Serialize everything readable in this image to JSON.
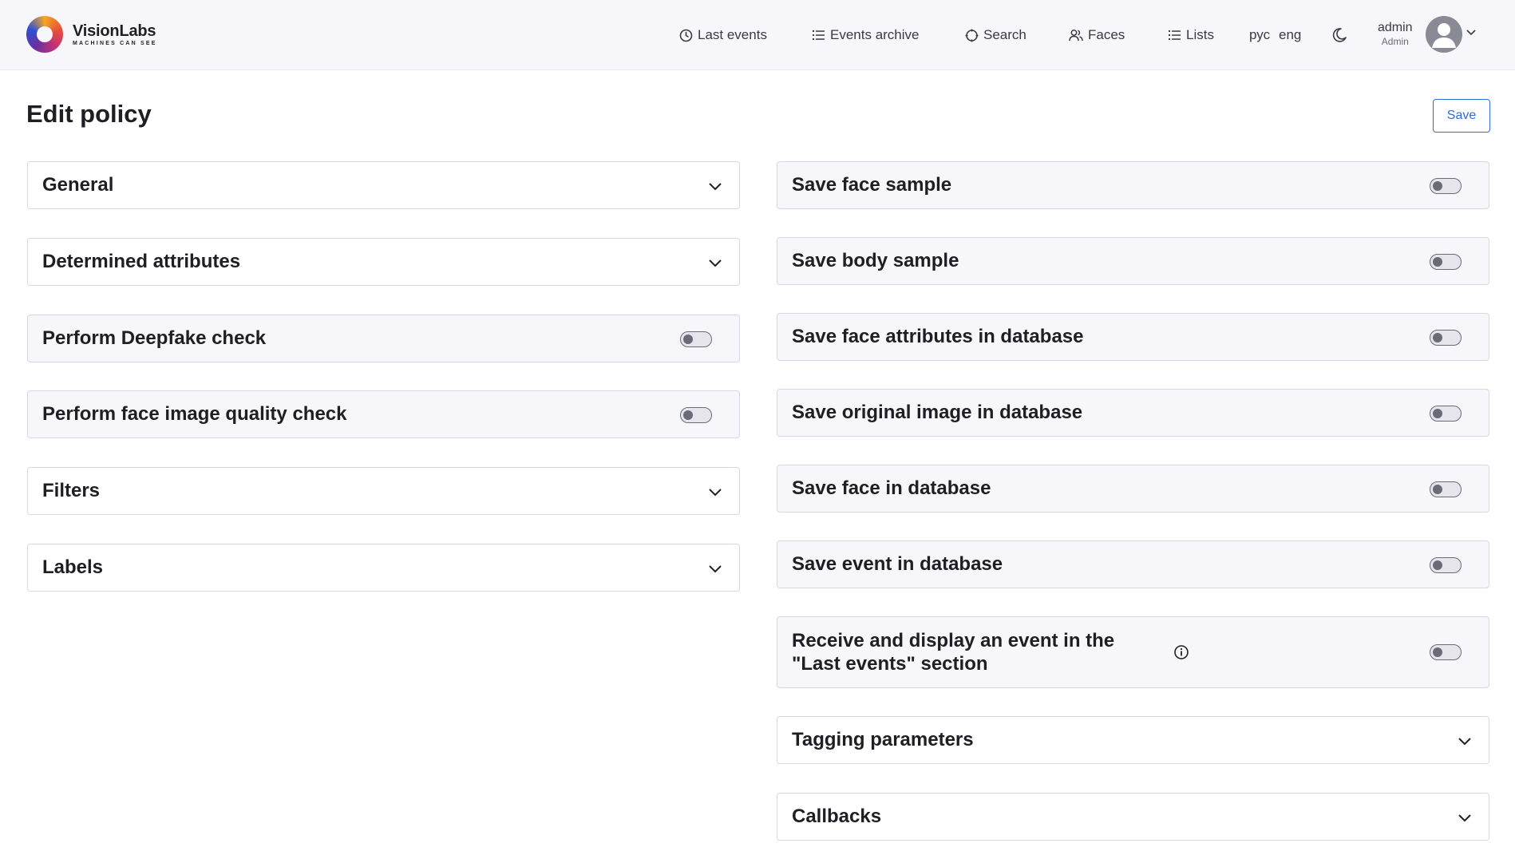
{
  "brand": {
    "name": "VisionLabs",
    "tagline": "MACHINES CAN SEE"
  },
  "nav": {
    "last_events": "Last events",
    "events_archive": "Events archive",
    "search": "Search",
    "faces": "Faces",
    "lists": "Lists",
    "lang_ru": "рус",
    "lang_en": "eng"
  },
  "user": {
    "name": "admin",
    "role": "Admin"
  },
  "page": {
    "title": "Edit policy",
    "save_label": "Save"
  },
  "left_sections": {
    "general": "General",
    "determined_attributes": "Determined attributes",
    "deepfake": "Perform Deepfake check",
    "quality": "Perform face image quality check",
    "filters": "Filters",
    "labels": "Labels"
  },
  "right_sections": {
    "save_face_sample": "Save face sample",
    "save_body_sample": "Save body sample",
    "save_face_attributes": "Save face attributes in database",
    "save_original_image": "Save original image in database",
    "save_face": "Save face in database",
    "save_event": "Save event in database",
    "receive_display_line1": "Receive and display an event in the",
    "receive_display_line2": "\"Last events\" section",
    "tagging": "Tagging parameters",
    "callbacks": "Callbacks"
  },
  "toggles": {
    "deepfake": false,
    "quality": false,
    "save_face_sample": false,
    "save_body_sample": false,
    "save_face_attributes": false,
    "save_original_image": false,
    "save_face": false,
    "save_event": false,
    "receive_display": false
  },
  "colors": {
    "accent": "#2f6cd6",
    "header_bg": "#f7f6fb",
    "card_border": "#d9d7e2"
  }
}
